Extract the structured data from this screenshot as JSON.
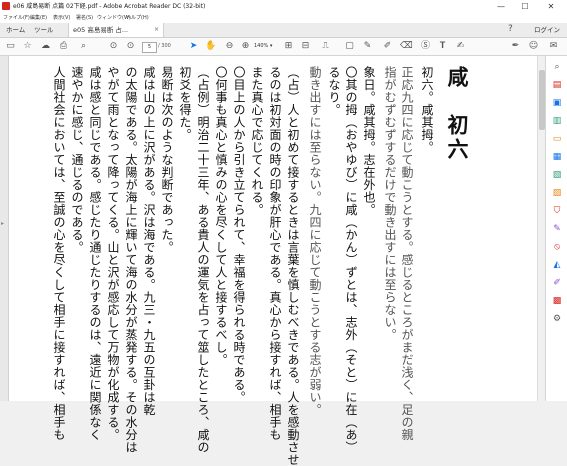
{
  "window": {
    "title": "e06 咸島易断 点篇 02下経.pdf - Adobe Acrobat Reader DC (32-bit)",
    "minimize": "—",
    "maximize": "☐",
    "close": "✕"
  },
  "menu": [
    "ファイル(F)",
    "編集(E)",
    "表示(V)",
    "署名(S)",
    "ウィンドウ(W)",
    "ヘルプ(H)"
  ],
  "tabs": {
    "home": "ホーム",
    "tools": "ツール",
    "document": "e05 高島易断 占...",
    "close": "×",
    "help": "?",
    "login": "ログイン"
  },
  "toolbar": {
    "page_current": "5",
    "page_total": "/ 300",
    "zoom": "140%"
  },
  "document": {
    "heading": "咸　初六",
    "columns": [
      "初六。咸其拇。",
      "正応九四に応じて動こうとする。感じるところがまだ浅く、足の親",
      "指がむずむずするだけで動き出すには至らない。",
      "象日。咸其拇。志在外也。",
      "〇其の拇（おやゆび）に咸（かん）ずとは、志外（そと）に在（あ）",
      "るなり。",
      "動き出すには至らない。九四に応じて動こうとする志が弱い。",
      "（占）人と初めて接するときは言葉を慎しむべきである。人を感動させ",
      "るのは初対面の時の印象が肝心である。真心から接すれば、相手も",
      "また真心で応じてくれる。",
      "〇目上の人から引き立てられて、幸福を得られる時である。",
      "〇何事も真心と慎みの心を尽くして人と接するべし。",
      "（占例）明治二十三年、ある貴人の運気を占って筮したところ、咸の",
      "初爻を得た。",
      "易断は次のような判断であった。",
      "咸は山の上に沢がある。沢は海である。九三・九五の互卦は乾",
      "の太陽である。太陽が海上に輝いて海の水分が蒸発する。その水分は",
      "やがて雨となって降ってくる。山と沢が感応して万物が化成する。",
      "咸は感と同じである。感じたり通じたりするのは、遠近に関係なく",
      "速やかに感じ、通じるのである。",
      "人間社会においては、至誠の心を尽くして相手に接すれば、相手も"
    ]
  }
}
